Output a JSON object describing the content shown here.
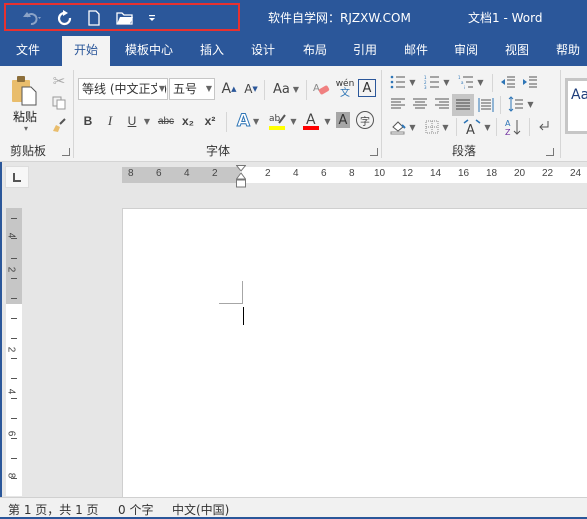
{
  "window": {
    "site_title": "软件自学网：RJZXW.COM",
    "doc_title": "文档1  -  Word",
    "accent": "#2b579a",
    "highlight_box_color": "#e8312f"
  },
  "qat": {
    "undo": "undo-icon",
    "redo": "redo-icon",
    "new": "new-document-icon",
    "open": "open-folder-icon",
    "customize": "customize-qat-icon"
  },
  "tabs": [
    {
      "label": "文件",
      "active": false
    },
    {
      "label": "开始",
      "active": true
    },
    {
      "label": "模板中心",
      "active": false
    },
    {
      "label": "插入",
      "active": false
    },
    {
      "label": "设计",
      "active": false
    },
    {
      "label": "布局",
      "active": false
    },
    {
      "label": "引用",
      "active": false
    },
    {
      "label": "邮件",
      "active": false
    },
    {
      "label": "审阅",
      "active": false
    },
    {
      "label": "视图",
      "active": false
    },
    {
      "label": "帮助",
      "active": false
    }
  ],
  "ribbon": {
    "clipboard": {
      "label": "剪贴板",
      "paste_label": "粘贴"
    },
    "font": {
      "label": "字体",
      "font_name": "等线 (中文正文)",
      "font_size": "五号",
      "change_case": "Aa",
      "bold": "B",
      "italic": "I",
      "underline": "U",
      "strikethrough": "abc",
      "subscript": "x₂",
      "superscript": "x²",
      "phonetic_top": "wén",
      "phonetic_bottom": "文",
      "enclose_char": "字",
      "highlight_color": "#ffff00",
      "font_color": "#ff0000"
    },
    "paragraph": {
      "label": "段落"
    },
    "styles": {
      "preview": "Aa"
    }
  },
  "ruler": {
    "horizontal_left": [
      "8",
      "6",
      "4",
      "2"
    ],
    "horizontal_right": [
      "2",
      "4",
      "6",
      "8",
      "10",
      "12",
      "14",
      "16",
      "18",
      "20",
      "22",
      "24"
    ],
    "vertical_top": [
      "4",
      "2"
    ],
    "vertical_bottom": [
      "2",
      "4",
      "6",
      "8"
    ]
  },
  "status": {
    "page": "第 1 页，共 1 页",
    "words": "0 个字",
    "language": "中文(中国)"
  }
}
